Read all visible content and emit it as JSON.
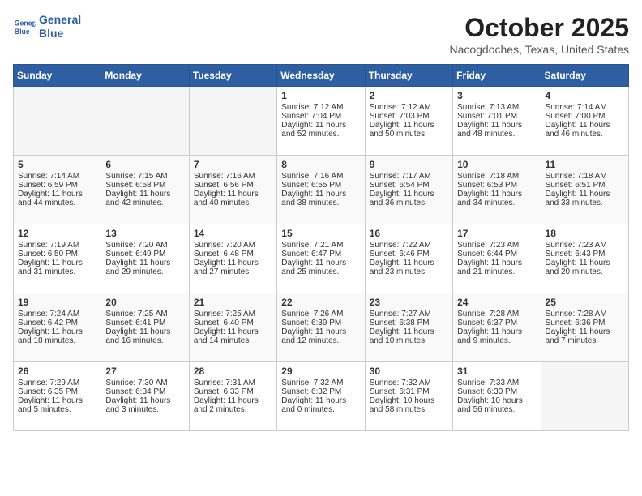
{
  "header": {
    "logo_line1": "General",
    "logo_line2": "Blue",
    "month": "October 2025",
    "location": "Nacogdoches, Texas, United States"
  },
  "days_of_week": [
    "Sunday",
    "Monday",
    "Tuesday",
    "Wednesday",
    "Thursday",
    "Friday",
    "Saturday"
  ],
  "weeks": [
    [
      {
        "day": "",
        "info": ""
      },
      {
        "day": "",
        "info": ""
      },
      {
        "day": "",
        "info": ""
      },
      {
        "day": "1",
        "sunrise": "Sunrise: 7:12 AM",
        "sunset": "Sunset: 7:04 PM",
        "daylight": "Daylight: 11 hours and 52 minutes."
      },
      {
        "day": "2",
        "sunrise": "Sunrise: 7:12 AM",
        "sunset": "Sunset: 7:03 PM",
        "daylight": "Daylight: 11 hours and 50 minutes."
      },
      {
        "day": "3",
        "sunrise": "Sunrise: 7:13 AM",
        "sunset": "Sunset: 7:01 PM",
        "daylight": "Daylight: 11 hours and 48 minutes."
      },
      {
        "day": "4",
        "sunrise": "Sunrise: 7:14 AM",
        "sunset": "Sunset: 7:00 PM",
        "daylight": "Daylight: 11 hours and 46 minutes."
      }
    ],
    [
      {
        "day": "5",
        "sunrise": "Sunrise: 7:14 AM",
        "sunset": "Sunset: 6:59 PM",
        "daylight": "Daylight: 11 hours and 44 minutes."
      },
      {
        "day": "6",
        "sunrise": "Sunrise: 7:15 AM",
        "sunset": "Sunset: 6:58 PM",
        "daylight": "Daylight: 11 hours and 42 minutes."
      },
      {
        "day": "7",
        "sunrise": "Sunrise: 7:16 AM",
        "sunset": "Sunset: 6:56 PM",
        "daylight": "Daylight: 11 hours and 40 minutes."
      },
      {
        "day": "8",
        "sunrise": "Sunrise: 7:16 AM",
        "sunset": "Sunset: 6:55 PM",
        "daylight": "Daylight: 11 hours and 38 minutes."
      },
      {
        "day": "9",
        "sunrise": "Sunrise: 7:17 AM",
        "sunset": "Sunset: 6:54 PM",
        "daylight": "Daylight: 11 hours and 36 minutes."
      },
      {
        "day": "10",
        "sunrise": "Sunrise: 7:18 AM",
        "sunset": "Sunset: 6:53 PM",
        "daylight": "Daylight: 11 hours and 34 minutes."
      },
      {
        "day": "11",
        "sunrise": "Sunrise: 7:18 AM",
        "sunset": "Sunset: 6:51 PM",
        "daylight": "Daylight: 11 hours and 33 minutes."
      }
    ],
    [
      {
        "day": "12",
        "sunrise": "Sunrise: 7:19 AM",
        "sunset": "Sunset: 6:50 PM",
        "daylight": "Daylight: 11 hours and 31 minutes."
      },
      {
        "day": "13",
        "sunrise": "Sunrise: 7:20 AM",
        "sunset": "Sunset: 6:49 PM",
        "daylight": "Daylight: 11 hours and 29 minutes."
      },
      {
        "day": "14",
        "sunrise": "Sunrise: 7:20 AM",
        "sunset": "Sunset: 6:48 PM",
        "daylight": "Daylight: 11 hours and 27 minutes."
      },
      {
        "day": "15",
        "sunrise": "Sunrise: 7:21 AM",
        "sunset": "Sunset: 6:47 PM",
        "daylight": "Daylight: 11 hours and 25 minutes."
      },
      {
        "day": "16",
        "sunrise": "Sunrise: 7:22 AM",
        "sunset": "Sunset: 6:46 PM",
        "daylight": "Daylight: 11 hours and 23 minutes."
      },
      {
        "day": "17",
        "sunrise": "Sunrise: 7:23 AM",
        "sunset": "Sunset: 6:44 PM",
        "daylight": "Daylight: 11 hours and 21 minutes."
      },
      {
        "day": "18",
        "sunrise": "Sunrise: 7:23 AM",
        "sunset": "Sunset: 6:43 PM",
        "daylight": "Daylight: 11 hours and 20 minutes."
      }
    ],
    [
      {
        "day": "19",
        "sunrise": "Sunrise: 7:24 AM",
        "sunset": "Sunset: 6:42 PM",
        "daylight": "Daylight: 11 hours and 18 minutes."
      },
      {
        "day": "20",
        "sunrise": "Sunrise: 7:25 AM",
        "sunset": "Sunset: 6:41 PM",
        "daylight": "Daylight: 11 hours and 16 minutes."
      },
      {
        "day": "21",
        "sunrise": "Sunrise: 7:25 AM",
        "sunset": "Sunset: 6:40 PM",
        "daylight": "Daylight: 11 hours and 14 minutes."
      },
      {
        "day": "22",
        "sunrise": "Sunrise: 7:26 AM",
        "sunset": "Sunset: 6:39 PM",
        "daylight": "Daylight: 11 hours and 12 minutes."
      },
      {
        "day": "23",
        "sunrise": "Sunrise: 7:27 AM",
        "sunset": "Sunset: 6:38 PM",
        "daylight": "Daylight: 11 hours and 10 minutes."
      },
      {
        "day": "24",
        "sunrise": "Sunrise: 7:28 AM",
        "sunset": "Sunset: 6:37 PM",
        "daylight": "Daylight: 11 hours and 9 minutes."
      },
      {
        "day": "25",
        "sunrise": "Sunrise: 7:28 AM",
        "sunset": "Sunset: 6:36 PM",
        "daylight": "Daylight: 11 hours and 7 minutes."
      }
    ],
    [
      {
        "day": "26",
        "sunrise": "Sunrise: 7:29 AM",
        "sunset": "Sunset: 6:35 PM",
        "daylight": "Daylight: 11 hours and 5 minutes."
      },
      {
        "day": "27",
        "sunrise": "Sunrise: 7:30 AM",
        "sunset": "Sunset: 6:34 PM",
        "daylight": "Daylight: 11 hours and 3 minutes."
      },
      {
        "day": "28",
        "sunrise": "Sunrise: 7:31 AM",
        "sunset": "Sunset: 6:33 PM",
        "daylight": "Daylight: 11 hours and 2 minutes."
      },
      {
        "day": "29",
        "sunrise": "Sunrise: 7:32 AM",
        "sunset": "Sunset: 6:32 PM",
        "daylight": "Daylight: 11 hours and 0 minutes."
      },
      {
        "day": "30",
        "sunrise": "Sunrise: 7:32 AM",
        "sunset": "Sunset: 6:31 PM",
        "daylight": "Daylight: 10 hours and 58 minutes."
      },
      {
        "day": "31",
        "sunrise": "Sunrise: 7:33 AM",
        "sunset": "Sunset: 6:30 PM",
        "daylight": "Daylight: 10 hours and 56 minutes."
      },
      {
        "day": "",
        "info": ""
      }
    ]
  ]
}
